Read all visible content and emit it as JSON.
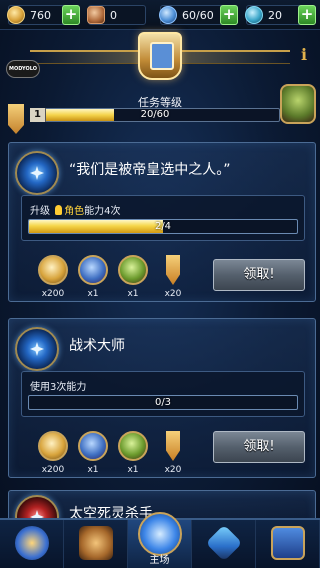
{
  "resources": [
    {
      "name": "credits",
      "value": "760",
      "icon": "credit-coin-icon",
      "has_plus": true
    },
    {
      "name": "chips",
      "value": "0",
      "icon": "chip-icon",
      "has_plus": false
    },
    {
      "name": "energy",
      "value": "60/60",
      "icon": "energy-icon",
      "has_plus": true
    },
    {
      "name": "tokens",
      "value": "20",
      "icon": "token-icon",
      "has_plus": true
    }
  ],
  "header": {
    "watermark": "MODYOLO",
    "info": "i"
  },
  "rank": {
    "label": "任务等级",
    "level": "1",
    "progress_text": "20/60",
    "progress_fraction": 0.333
  },
  "quests": [
    {
      "title": "“我们是被帝皇选中之人。”",
      "objective_prefix": "升级",
      "objective_highlight": "角色",
      "objective_suffix": "能力4次",
      "progress_text": "2/4",
      "progress_fraction": 0.5,
      "rewards": [
        {
          "icon": "gold-skull-icon",
          "qty": "x200"
        },
        {
          "icon": "blue-portrait-icon",
          "qty": "x1"
        },
        {
          "icon": "green-emblem-icon",
          "qty": "x1"
        },
        {
          "icon": "medal-icon",
          "qty": "x20"
        }
      ],
      "claim_label": "领取!"
    },
    {
      "title": "战术大师",
      "objective": "使用3次能力",
      "progress_text": "0/3",
      "progress_fraction": 0,
      "rewards": [
        {
          "icon": "gold-skull-icon",
          "qty": "x200"
        },
        {
          "icon": "blue-portrait-icon",
          "qty": "x1"
        },
        {
          "icon": "green-emblem-icon",
          "qty": "x1"
        },
        {
          "icon": "medal-icon",
          "qty": "x20"
        }
      ],
      "claim_label": "领取!"
    },
    {
      "title": "太空死灵杀手"
    }
  ],
  "nav": {
    "items": [
      {
        "icon": "character-icon",
        "label": ""
      },
      {
        "icon": "laurel-helmet-icon",
        "label": ""
      },
      {
        "icon": "globe-icon",
        "label": "主场"
      },
      {
        "icon": "sword-icon",
        "label": ""
      },
      {
        "icon": "guild-banner-icon",
        "label": ""
      }
    ]
  },
  "colors": {
    "accent_gold": "#f4d34b",
    "plus_green": "#2e8a25",
    "background": "#0b1a33"
  }
}
